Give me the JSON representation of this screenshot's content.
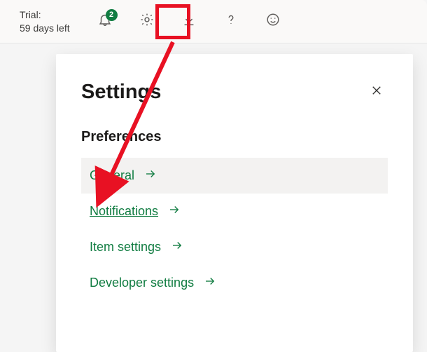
{
  "topbar": {
    "trial_line1": "Trial:",
    "trial_line2": "59 days left",
    "notification_count": "2"
  },
  "panel": {
    "title": "Settings",
    "section_title": "Preferences",
    "items": [
      {
        "label": "General"
      },
      {
        "label": "Notifications"
      },
      {
        "label": "Item settings"
      },
      {
        "label": "Developer settings"
      }
    ]
  },
  "icons": {
    "bell": "bell-icon",
    "gear": "gear-icon",
    "download": "download-icon",
    "help": "help-icon",
    "smiley": "smiley-icon",
    "close": "close-icon"
  },
  "annotation": {
    "highlight_color": "#e81123"
  }
}
